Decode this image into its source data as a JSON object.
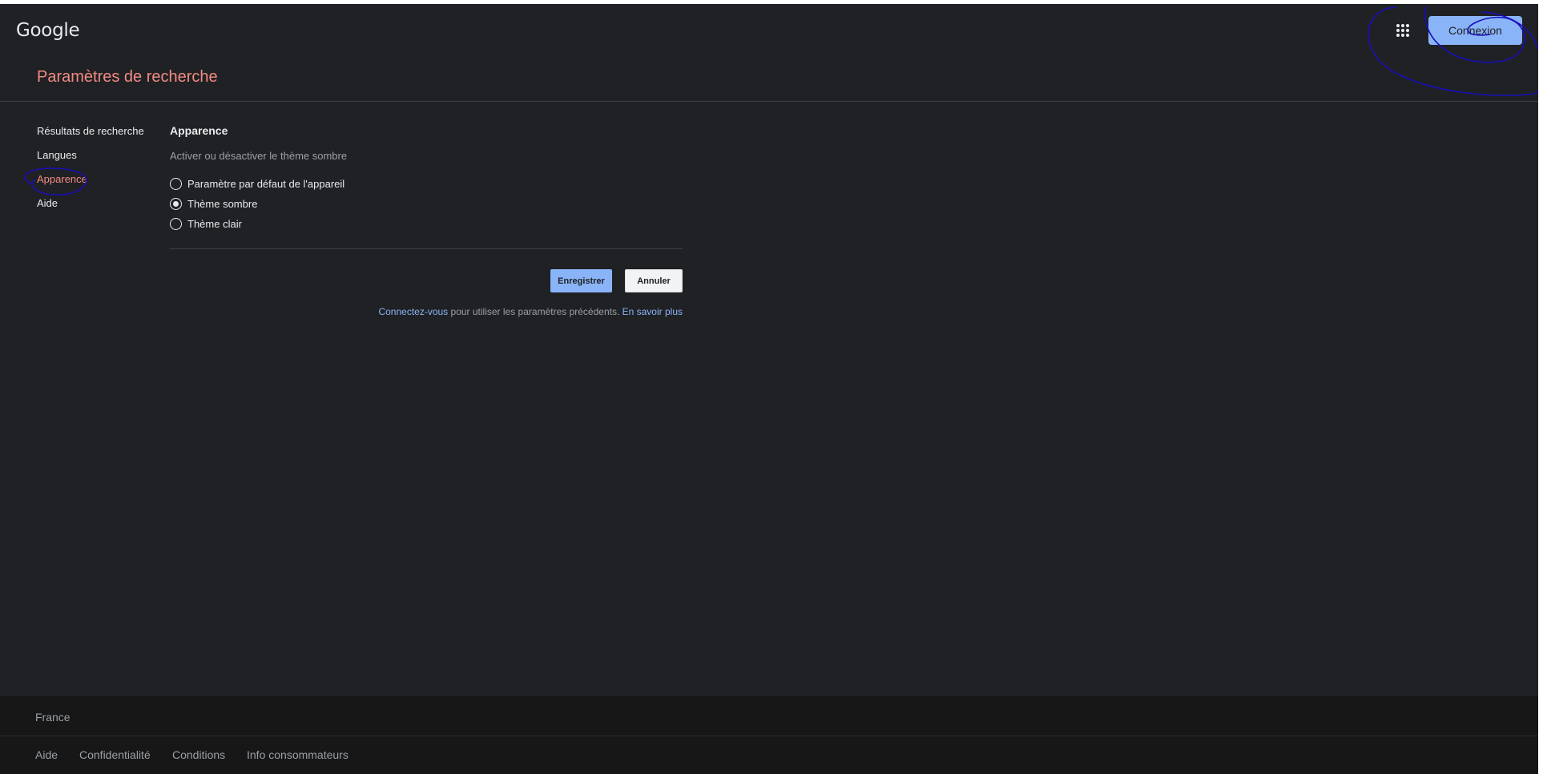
{
  "header": {
    "logo": "Google",
    "signin_label": "Connexion",
    "apps_icon": "apps-grid-icon"
  },
  "page": {
    "title": "Paramètres de recherche"
  },
  "nav": {
    "items": [
      {
        "label": "Résultats de recherche"
      },
      {
        "label": "Langues"
      },
      {
        "label": "Apparence"
      },
      {
        "label": "Aide"
      }
    ],
    "active": "Apparence"
  },
  "appearance": {
    "title": "Apparence",
    "description": "Activer ou désactiver le thème sombre",
    "options": [
      {
        "label": "Paramètre par défaut de l'appareil",
        "selected": false
      },
      {
        "label": "Thème sombre",
        "selected": true
      },
      {
        "label": "Thème clair",
        "selected": false
      }
    ]
  },
  "actions": {
    "save_label": "Enregistrer",
    "cancel_label": "Annuler"
  },
  "signin_note": {
    "link_label": "Connectez-vous",
    "text": " pour utiliser les paramètres précédents. ",
    "learn_more_label": "En savoir plus"
  },
  "footer": {
    "country": "France",
    "links": [
      "Aide",
      "Confidentialité",
      "Conditions",
      "Info consommateurs"
    ]
  },
  "colors": {
    "background": "#202124",
    "accent_active": "#f28b82",
    "link": "#8ab4f8",
    "annotation_ink": "#1a0fb8"
  }
}
